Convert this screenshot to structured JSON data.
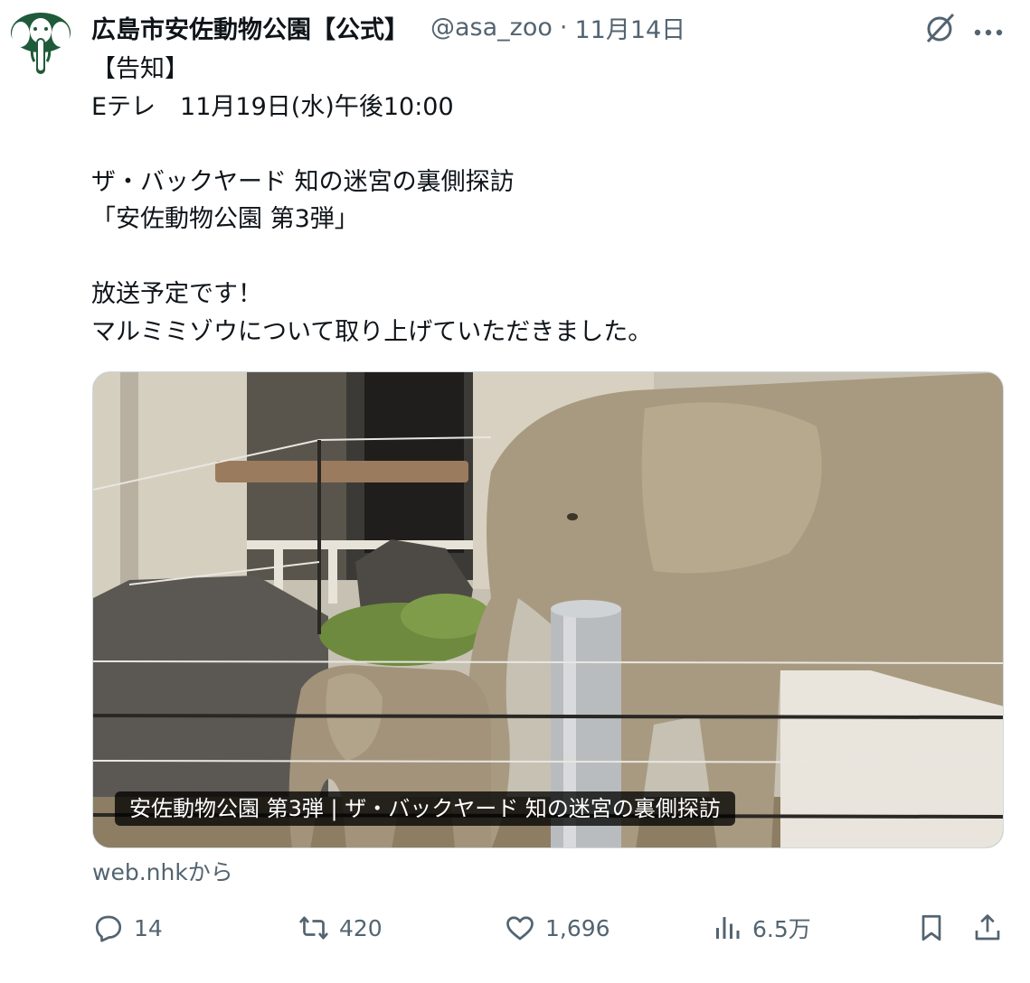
{
  "author": {
    "display_name": "広島市安佐動物公園【公式】",
    "handle": "@asa_zoo",
    "separator": "·",
    "date": "11月14日",
    "avatar_icon": "elephant-logo-icon"
  },
  "tweet": {
    "text": "【告知】\nEテレ　11月19日(水)午後10:00\n\nザ・バックヤード 知の迷宮の裏側探訪\n「安佐動物公園 第3弾」\n\n放送予定です！\nマルミミゾウについて取り上げていただきました。"
  },
  "media": {
    "caption": "安佐動物公園 第3弾 | ザ・バックヤード 知の迷宮の裏側探訪",
    "source": "web.nhkから"
  },
  "actions": {
    "replies": "14",
    "retweets": "420",
    "likes": "1,696",
    "views": "6.5万"
  },
  "colors": {
    "text": "#0f1419",
    "secondary": "#536471",
    "logo_green": "#1f5a3a"
  }
}
